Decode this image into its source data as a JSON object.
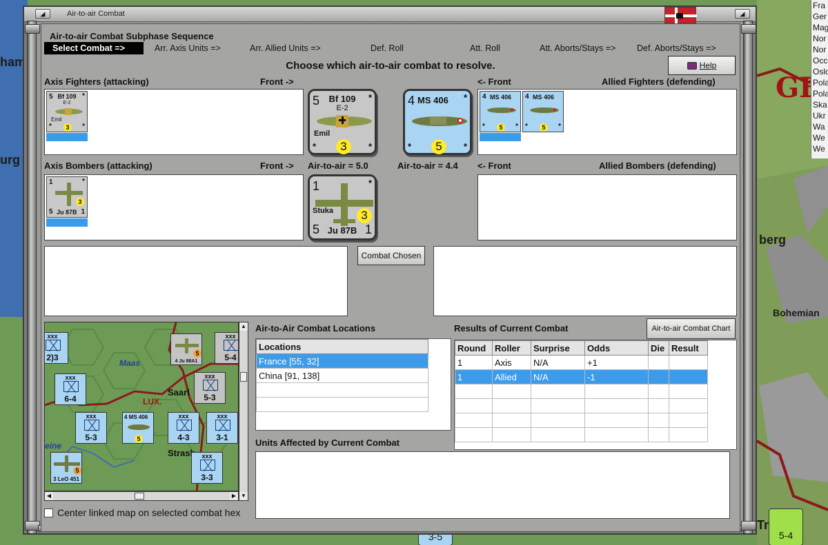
{
  "background": {
    "labels": [
      "ham",
      "urg",
      "GER",
      "berg",
      "Bohemian",
      "Tr"
    ],
    "right_list": [
      "Fra",
      "Ger",
      "Mag",
      "Nor",
      "Nor",
      "Occ",
      "Oslo",
      "Pola",
      "Pola",
      "Ska",
      "Ukr",
      "Wa",
      "We",
      "We"
    ],
    "bottom_counter_left": "3-5",
    "bottom_counter_right": "5-4"
  },
  "window": {
    "title": "Air-to-air Combat"
  },
  "sequence": {
    "title": "Air-to-air Combat Subphase Sequence",
    "steps": [
      "Select Combat =>",
      "Arr. Axis Units =>",
      "Arr. Allied Units =>",
      "Def. Roll",
      "Att. Roll",
      "Att. Aborts/Stays =>",
      "Def. Aborts/Stays =>"
    ]
  },
  "prompt": "Choose which air-to-air combat to resolve.",
  "help_label": "Help",
  "sections": {
    "axis_fighters": "Axis Fighters (attacking)",
    "allied_fighters": "Allied Fighters (defending)",
    "axis_bombers": "Axis Bombers (attacking)",
    "allied_bombers": "Allied Bombers (defending)",
    "front_right": "Front ->",
    "front_left": "<- Front",
    "axis_air_to_air": "Air-to-air = 5.0",
    "allied_air_to_air": "Air-to-air = 4.4"
  },
  "axis_fighter": {
    "air": "5",
    "name": "Bf 109",
    "model": "E-2",
    "pilot": "Emil",
    "range": "3",
    "mark": "*"
  },
  "allied_fighter": {
    "air": "4",
    "name": "MS 406",
    "range": "5",
    "mark": "*"
  },
  "axis_bomber": {
    "air": "1",
    "name": "Ju 87B",
    "pilot": "Stuka",
    "range": "3",
    "ground": "5",
    "naval": "1",
    "mark": "*"
  },
  "combat_chosen_label": "Combat Chosen",
  "locations": {
    "title": "Air-to-Air Combat Locations",
    "header": "Locations",
    "rows": [
      "France [55, 32]",
      "China [91, 138]"
    ],
    "selected_index": 0
  },
  "results": {
    "title": "Results of Current Combat",
    "chart_button": "Air-to-air Combat Chart",
    "headers": [
      "Round",
      "Roller",
      "Surprise",
      "Odds",
      "Die",
      "Result"
    ],
    "rows": [
      [
        "1",
        "Axis",
        "N/A",
        "+1",
        "",
        ""
      ],
      [
        "1",
        "Allied",
        "N/A",
        "-1",
        "",
        ""
      ]
    ],
    "selected_index": 1
  },
  "units_affected_title": "Units Affected by Current Combat",
  "center_map_label": "Center linked map on selected combat hex",
  "mini_map": {
    "labels": [
      "Maas",
      "Saarl",
      "LUX.",
      "Strasb",
      "eine"
    ],
    "counters": [
      {
        "top": "xxx",
        "str": "2)3"
      },
      {
        "top": "xxx",
        "str": "6-4"
      },
      {
        "top": "xxx",
        "str": "5-3"
      },
      {
        "top": "xxx",
        "str": "4-3"
      },
      {
        "top": "xxx",
        "str": "3-1"
      },
      {
        "top": "xxx",
        "str": "5-3"
      },
      {
        "top": "xxx",
        "str": "5-4"
      },
      {
        "top": "xxx",
        "str": "3-3"
      }
    ],
    "plane_labels": [
      "4 Ju 88A1",
      "4 MS 406",
      "3 LeO 451"
    ],
    "plane_ranges": [
      "5",
      "5",
      "5"
    ]
  }
}
